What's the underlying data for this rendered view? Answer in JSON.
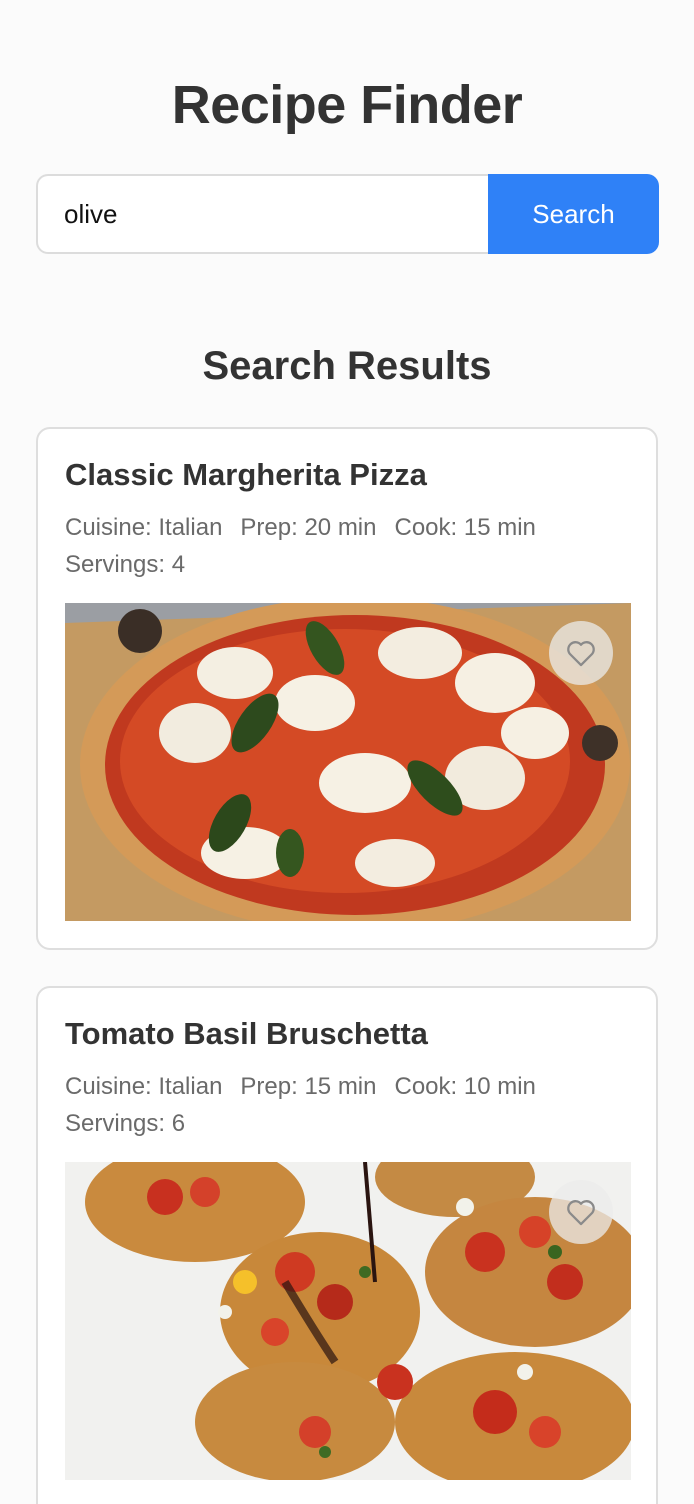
{
  "header": {
    "title": "Recipe Finder"
  },
  "search": {
    "value": "olive",
    "button_label": "Search"
  },
  "results": {
    "heading": "Search Results",
    "recipes": [
      {
        "title": "Classic Margherita Pizza",
        "cuisine": "Cuisine: Italian",
        "prep": "Prep: 20 min",
        "cook": "Cook: 15 min",
        "servings": "Servings: 4",
        "image_icon": "pizza-photo",
        "favorite_icon": "heart-outline-icon"
      },
      {
        "title": "Tomato Basil Bruschetta",
        "cuisine": "Cuisine: Italian",
        "prep": "Prep: 15 min",
        "cook": "Cook: 10 min",
        "servings": "Servings: 6",
        "image_icon": "bruschetta-photo",
        "favorite_icon": "heart-outline-icon"
      }
    ]
  },
  "colors": {
    "accent": "#2f81f7",
    "text": "#333333",
    "muted": "#6a6a6a"
  }
}
